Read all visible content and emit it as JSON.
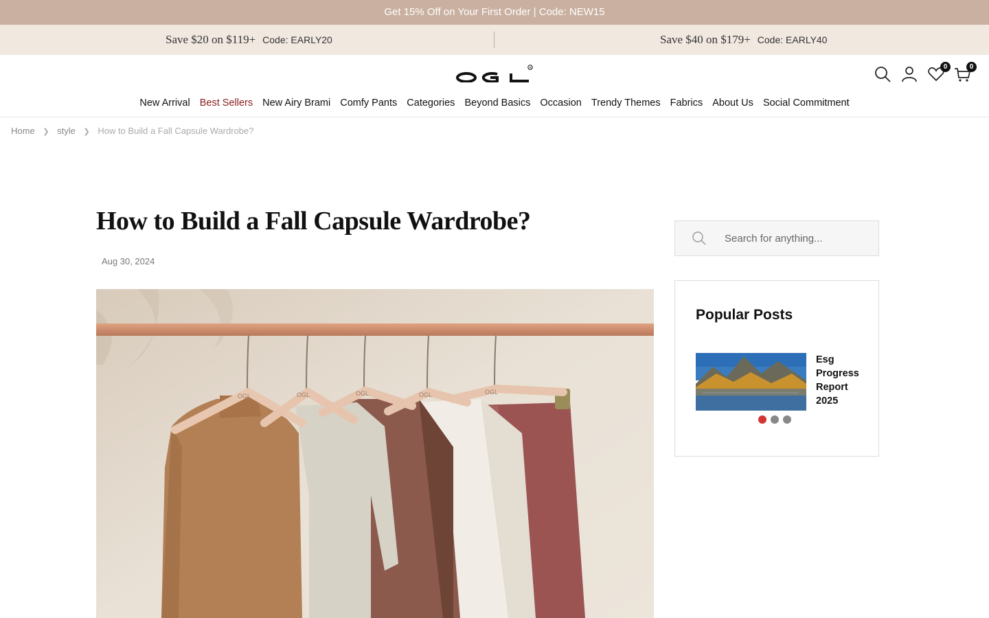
{
  "announcement": "Get 15% Off on Your First Order | Code: NEW15",
  "promos": [
    {
      "offer": "Save $20 on $119+",
      "code": "Code: EARLY20"
    },
    {
      "offer": "Save $40 on $179+",
      "code": "Code: EARLY40"
    }
  ],
  "header": {
    "logo_text": "OGL",
    "wishlist_count": "0",
    "cart_count": "0"
  },
  "nav": {
    "items": [
      "New Arrival",
      "Best Sellers",
      "New Airy Brami",
      "Comfy Pants",
      "Categories",
      "Beyond Basics",
      "Occasion",
      "Trendy Themes",
      "Fabrics",
      "About Us",
      "Social Commitment"
    ],
    "active_index": 1,
    "active_color": "#8b1c1c"
  },
  "breadcrumb": {
    "home": "Home",
    "category": "style",
    "current": "How to Build a Fall Capsule Wardrobe?"
  },
  "post": {
    "title": "How to Build a Fall Capsule Wardrobe?",
    "date": "Aug 30, 2024",
    "hanger_label": "OGL"
  },
  "sidebar": {
    "search_placeholder": "Search for anything...",
    "popular_title": "Popular Posts",
    "popular_posts": [
      {
        "title": "Esg Progress Report 2025"
      }
    ],
    "carousel_dots": 3,
    "carousel_active": 0
  },
  "colors": {
    "topbar_bg": "#c9b0a0",
    "promo_bg": "#f1e8e0",
    "accent_red": "#d33535"
  }
}
